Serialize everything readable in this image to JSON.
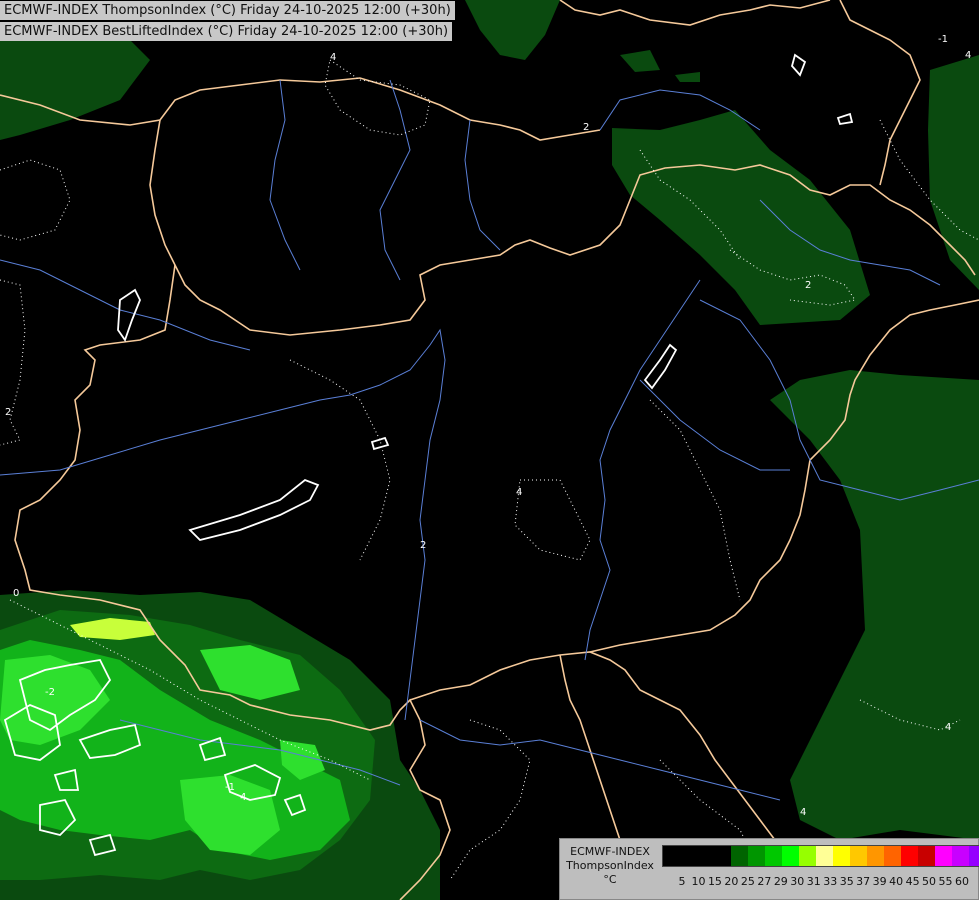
{
  "header": {
    "line1": "ECMWF-INDEX ThompsonIndex (°C) Friday 24-10-2025 12:00 (+30h)",
    "line2": "ECMWF-INDEX BestLiftedIndex (°C) Friday 24-10-2025 12:00 (+30h)"
  },
  "legend": {
    "title": "ECMWF-INDEX",
    "variable": "ThompsonIndex",
    "unit": "°C",
    "swatches": [
      "#000000",
      "#000000",
      "#000000",
      "#000000",
      "#006400",
      "#009600",
      "#00c800",
      "#00ff00",
      "#96ff00",
      "#ffff96",
      "#ffff00",
      "#ffc800",
      "#ff9600",
      "#ff6400",
      "#ff0000",
      "#c80000",
      "#ff00ff",
      "#c800ff",
      "#9600ff",
      "#6400ff",
      "#0000ff"
    ],
    "ticks": [
      "5",
      "10",
      "15",
      "20",
      "25",
      "27",
      "29",
      "30",
      "31",
      "33",
      "35",
      "37",
      "39",
      "40",
      "45",
      "50",
      "55",
      "60"
    ]
  },
  "contour_labels": [
    "4",
    "2",
    "-1",
    "2",
    "0",
    "-2",
    "2",
    "-1",
    "4",
    "4",
    "2",
    "4",
    "4",
    "4"
  ],
  "colors": {
    "background": "#000000",
    "field_dark": "#0a4a0f",
    "field_mid": "#0d6b12",
    "field_bright": "#12b31a",
    "field_light": "#2ee02e",
    "field_yellow": "#c8ff3a",
    "border": "#f5c99a",
    "river": "#5a7fd6",
    "contour_dotted": "#ffffff",
    "contour_solid": "#ffffff"
  }
}
